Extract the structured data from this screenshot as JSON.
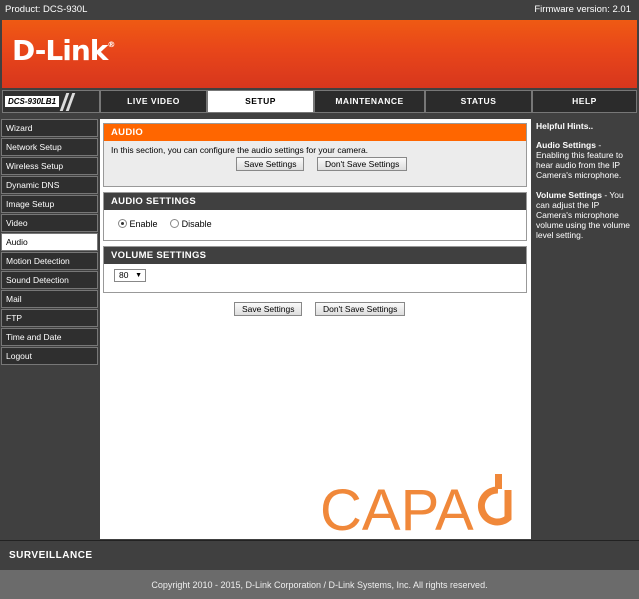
{
  "topbar": {
    "product": "Product: DCS-930L",
    "firmware": "Firmware version: 2.01"
  },
  "brand": {
    "logo": "D-Link",
    "reg": "®"
  },
  "nav": {
    "model": "DCS-930LB1",
    "tabs": [
      "LIVE VIDEO",
      "SETUP",
      "MAINTENANCE",
      "STATUS",
      "HELP"
    ],
    "active_tab": "SETUP"
  },
  "sidebar": {
    "items": [
      "Wizard",
      "Network Setup",
      "Wireless Setup",
      "Dynamic DNS",
      "Image Setup",
      "Video",
      "Audio",
      "Motion Detection",
      "Sound Detection",
      "Mail",
      "FTP",
      "Time and Date",
      "Logout"
    ],
    "active": "Audio"
  },
  "audio_panel": {
    "title": "AUDIO",
    "description": "In this section, you can configure the audio settings for your camera.",
    "save_label": "Save Settings",
    "dont_save_label": "Don't Save Settings"
  },
  "audio_settings": {
    "title": "AUDIO SETTINGS",
    "enable_label": "Enable",
    "disable_label": "Disable",
    "selected": "Enable"
  },
  "volume_settings": {
    "title": "VOLUME SETTINGS",
    "value": "80"
  },
  "bottom_buttons": {
    "save_label": "Save Settings",
    "dont_save_label": "Don't Save Settings"
  },
  "hints": {
    "title": "Helpful Hints..",
    "audio_term": "Audio Settings",
    "audio_text": " - Enabling this feature to hear audio from the IP Camera's microphone.",
    "volume_term": "Volume Settings",
    "volume_text": " - You can adjust the IP Camera's microphone volume using the volume level setting."
  },
  "watermark": "CAPA",
  "colors": {
    "orange": "#ff6600",
    "dark": "#404040",
    "watermark": "#f0883a"
  },
  "surveillance": "SURVEILLANCE",
  "footer": "Copyright 2010 - 2015, D-Link Corporation / D-Link Systems, Inc. All rights reserved."
}
